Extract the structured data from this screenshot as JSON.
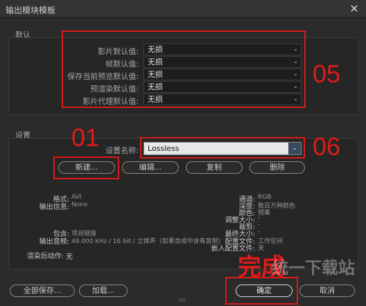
{
  "window": {
    "title": "输出模块模板",
    "close_glyph": "✕"
  },
  "defaults": {
    "section_label": "默认",
    "rows": [
      {
        "label": "影片默认值:",
        "value": "无损"
      },
      {
        "label": "帧默认值:",
        "value": "无损"
      },
      {
        "label": "保存当前预览默认值:",
        "value": "无损"
      },
      {
        "label": "预渲染默认值:",
        "value": "无损"
      },
      {
        "label": "影片代理默认值:",
        "value": "无损"
      }
    ]
  },
  "settings": {
    "section_label": "设置",
    "preset_name_label": "设置名称:",
    "preset_value": "Lossless",
    "buttons": {
      "new": "新建...",
      "edit": "编辑...",
      "duplicate": "复制",
      "delete": "删除"
    }
  },
  "info_left": {
    "format_label": "格式:",
    "format_value": "AVI",
    "output_info_label": "输出信息:",
    "output_info_value": "None",
    "include_label": "包含:",
    "include_value": "项目链接",
    "output_audio_label": "输出音频:",
    "output_audio_value": "48.000 kHz / 16 bit / 立体声（如果合成中含有音频）",
    "post_render_label": "渲染后动作:",
    "post_render_value": "无"
  },
  "info_right": {
    "channels_label": "通道:",
    "channels_value": "RGB",
    "depth_label": "深度:",
    "depth_value": "数百万种颜色",
    "color_label": "颜色:",
    "color_value": "预乘",
    "resize_label": "调整大小:",
    "resize_value": "-",
    "crop_label": "裁剪:",
    "crop_value": "-",
    "final_size_label": "最终大小:",
    "final_size_value": "-",
    "profile_label": "配置文件:",
    "profile_value": "工作空间",
    "embed_label": "嵌入配置文件:",
    "embed_value": "关"
  },
  "footer": {
    "save_all": "全部保存...",
    "load": "加载...",
    "ok": "确定",
    "cancel": "取消"
  },
  "annotations": {
    "num_01": "01",
    "num_05": "05",
    "num_06": "06",
    "done_text": "完成",
    "accent_color": "#e01a1a"
  },
  "watermark": {
    "text": "统一下载站",
    "small": "cn"
  }
}
